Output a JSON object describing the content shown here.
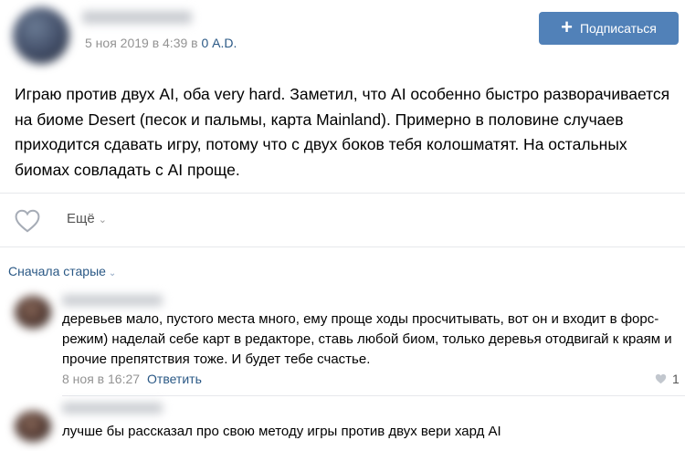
{
  "post": {
    "date": "5 ноя 2019 в 4:39",
    "date_separator": " в ",
    "group": "0 A.D.",
    "subscribe_label": "Подписаться",
    "text": "Играю против двух AI, оба very hard. Заметил, что AI особенно быстро разворачивается на биоме Desert (песок и пальмы, карта Mainland). Примерно в половине случаев приходится сдавать игру, потому что с двух боков тебя колошматят. На остальных биомах совладать с AI проще.",
    "more_label": "Ещё"
  },
  "comments_sort": {
    "label": "Сначала старые"
  },
  "comments": [
    {
      "text": "деревьев мало, пустого места много, ему проще ходы просчитывать, вот он и входит в форс-режим) наделай себе карт в редакторе, ставь любой биом, только деревья отодвигай к краям и прочие препятствия тоже. И будет тебе счастье.",
      "date": "8 ноя в 16:27",
      "reply_label": "Ответить",
      "likes": "1"
    },
    {
      "text": "лучше бы рассказал про свою методу игры против двух вери хард AI"
    }
  ],
  "colors": {
    "accent": "#5181b8",
    "link": "#2a5885",
    "muted": "#939393"
  }
}
